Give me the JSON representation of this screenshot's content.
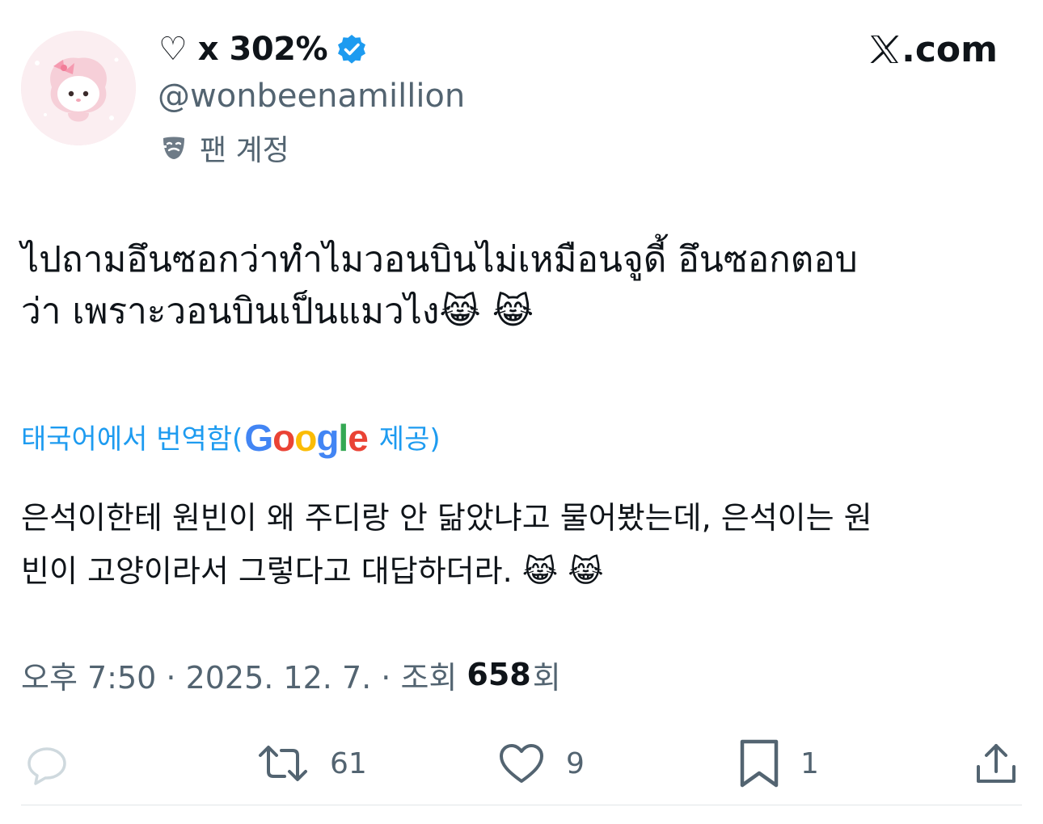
{
  "author": {
    "display_name": "♡ x 302%",
    "handle": "@wonbeenamillion",
    "account_label": "팬 계정",
    "verified": true,
    "avatar_icon": "sanrio-character-avatar"
  },
  "brand": {
    "logo_icon": "x-logo-icon",
    "text": ".com"
  },
  "tweet": {
    "original_text": "ไปถามอึนซอกว่าทำไมวอนบินไม่เหมือนจูดี้ อึนซอกตอบ\nว่า เพราะวอนบินเป็นแมวไง😹 😹",
    "translation_label": "태국어에서 번역함(",
    "translation_provider_suffix": " 제공)",
    "translated_text": "은석이한테 원빈이 왜 주디랑 안 닮았냐고 물어봤는데, 은석이는 원\n빈이 고양이라서 그렇다고 대답하더라. 😹 😹"
  },
  "meta": {
    "time_date": "오후 7:50 · 2025. 12. 7. · 조회",
    "views": "658",
    "views_suffix": "회"
  },
  "actions": {
    "reply_count": "",
    "retweet_count": "61",
    "like_count": "9",
    "bookmark_count": "1"
  },
  "colors": {
    "accent": "#1d9bf0",
    "text_primary": "#0f1419",
    "text_secondary": "#536471",
    "verified_badge": "#1d9bf0"
  }
}
